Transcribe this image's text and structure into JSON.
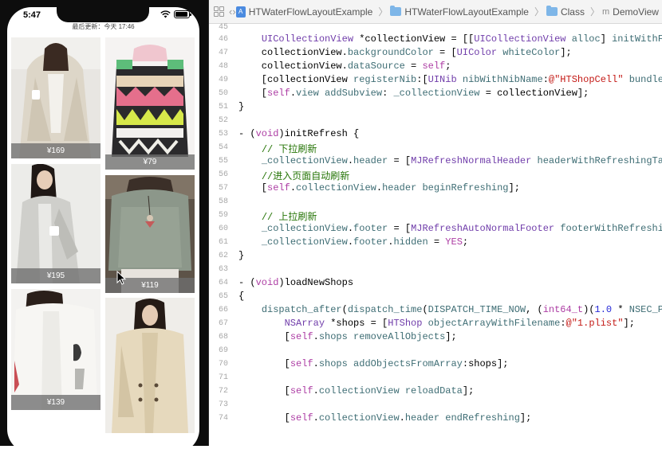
{
  "phone": {
    "status_time": "5:47",
    "refresh_text": "最后更新：今天 17:46",
    "products": [
      {
        "price": "¥169"
      },
      {
        "price": "¥79"
      },
      {
        "price": "¥195"
      },
      {
        "price": "¥119"
      },
      {
        "price": "¥139"
      },
      {
        "price": ""
      }
    ]
  },
  "jumpbar": {
    "items": [
      "HTWaterFlowLayoutExample",
      "HTWaterFlowLayoutExample",
      "Class",
      "DemoView"
    ]
  },
  "code": {
    "line_numbers": [
      "45",
      "46",
      "47",
      "48",
      "49",
      "50",
      "51",
      "52",
      "53",
      "54",
      "55",
      "56",
      "57",
      "58",
      "59",
      "60",
      "61",
      "62",
      "63",
      "64",
      "65",
      "66",
      "67",
      "68",
      "69",
      "70",
      "71",
      "72",
      "73",
      "74"
    ]
  },
  "colors": {
    "keyword": "#ad3da4",
    "class": "#703daa",
    "method": "#3e6d74",
    "comment": "#267507",
    "string": "#c41a16",
    "number": "#272ad8"
  }
}
